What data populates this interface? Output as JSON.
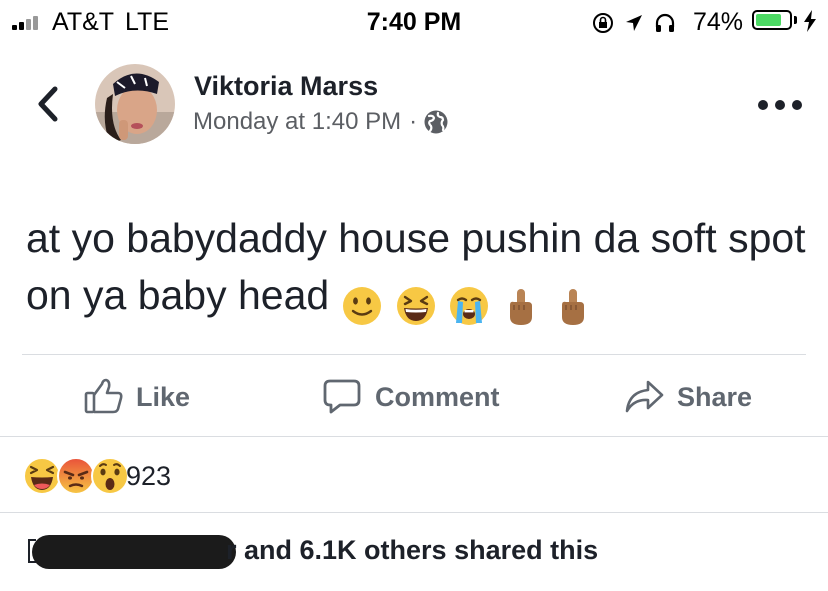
{
  "status_bar": {
    "carrier": "AT&T",
    "network": "LTE",
    "time": "7:40 PM",
    "battery_percent": "74%",
    "battery_level": 0.74,
    "icons": [
      "signal-bars-icon",
      "orientation-lock-icon",
      "location-arrow-icon",
      "headphones-icon",
      "battery-icon",
      "charging-bolt-icon"
    ]
  },
  "post": {
    "author": "Viktoria Marss",
    "timestamp": "Monday at 1:40 PM",
    "separator": "·",
    "privacy_icon": "globe-icon",
    "text": "at yo babydaddy house pushin da soft spot on ya baby head",
    "emojis": [
      "slightly-smiling-face",
      "grinning-squinting-face",
      "loudly-crying-face",
      "middle-finger-medium-skin",
      "middle-finger-medium-skin"
    ]
  },
  "actions": {
    "like": "Like",
    "comment": "Comment",
    "share": "Share"
  },
  "reactions": {
    "types": [
      "haha",
      "angry",
      "wow"
    ],
    "count": "923"
  },
  "shares": {
    "text": "r and 6.1K others shared this"
  },
  "colors": {
    "name": "#1d2129",
    "meta": "#5b5e63",
    "action": "#606770",
    "divider": "#dadde1",
    "battery_fill": "#4cd964",
    "reaction_yellow": "#f7c844",
    "reaction_angry": "#e9513a"
  }
}
